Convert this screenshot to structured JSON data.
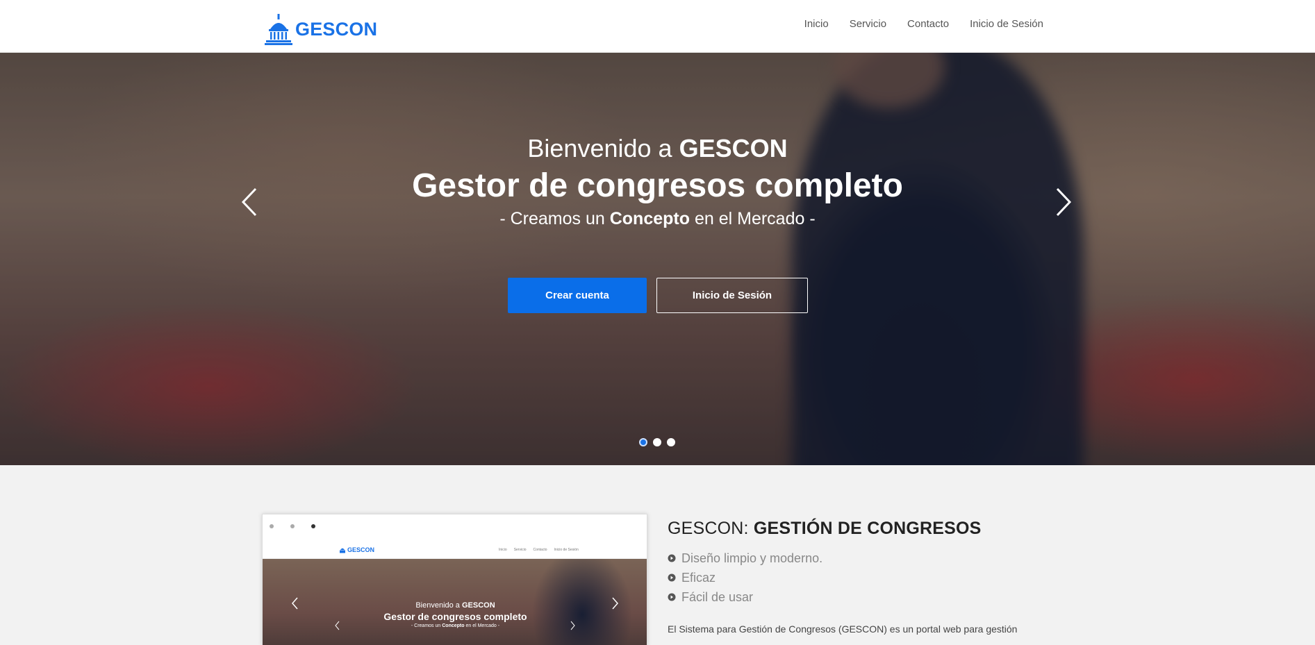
{
  "nav": {
    "brand": "GESCON",
    "links": [
      "Inicio",
      "Servicio",
      "Contacto",
      "Inicio de Sesión"
    ]
  },
  "hero": {
    "welcome_prefix": "Bienvenido a",
    "welcome_brand": "GESCON",
    "title": "Gestor de congresos completo",
    "tagline_prefix": "- Creamos un",
    "tagline_bold": "Concepto",
    "tagline_suffix": "en el Mercado -",
    "primary_button": "Crear cuenta",
    "secondary_button": "Inicio de Sesión"
  },
  "mockup": {
    "brand": "GESCON",
    "links": [
      "Inicio",
      "Servicio",
      "Contacto",
      "Inicio de Sesión"
    ],
    "welcome_prefix": "Bienvenido a",
    "welcome_brand": "GESCON",
    "title": "Gestor de congresos completo",
    "tagline_prefix": "- Creamos un",
    "tagline_bold": "Concepto",
    "tagline_suffix": "en el Mercado -"
  },
  "info": {
    "title_prefix": "GESCON:",
    "title_bold": "GESTIÓN DE CONGRESOS",
    "features": [
      "Diseño limpio y moderno.",
      "Eficaz",
      "Fácil de usar"
    ],
    "description": "El Sistema para Gestión de Congresos (GESCON) es un portal web para gestión"
  },
  "colors": {
    "accent": "#0a6ee9",
    "brand": "#1a72e6"
  }
}
